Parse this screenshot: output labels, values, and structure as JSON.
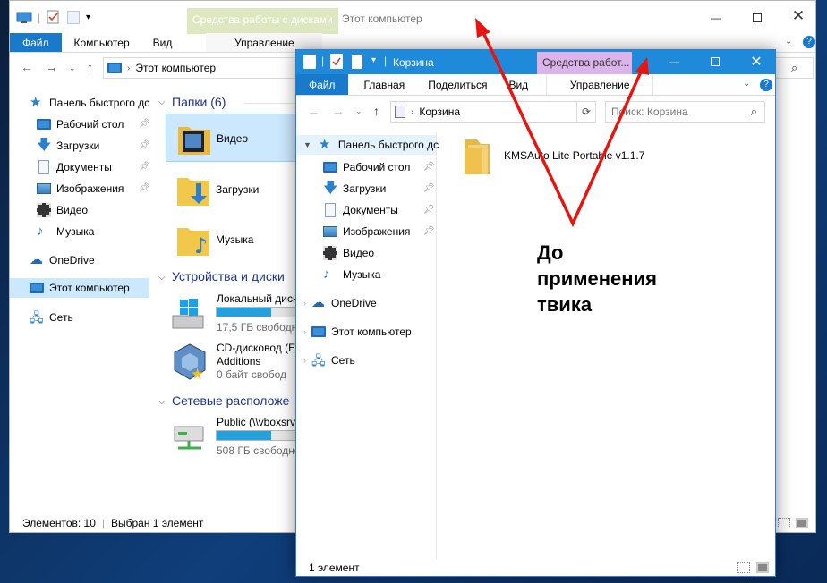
{
  "back": {
    "ribbon_context_label": "Средства работы с дисками",
    "title": "Этот компьютер",
    "tabs": [
      "Файл",
      "Компьютер",
      "Вид",
      "Управление"
    ],
    "address_root": "Этот компьютер",
    "nav": [
      "Панель быстрого дс",
      "Рабочий стол",
      "Загрузки",
      "Документы",
      "Изображения",
      "Видео",
      "Музыка",
      "OneDrive",
      "Этот компьютер",
      "Сеть"
    ],
    "groups": [
      "Папки (6)",
      "Устройства и диски",
      "Сетевые расположе"
    ],
    "folders": [
      "Видео",
      "Загрузки",
      "Музыка"
    ],
    "drives": [
      {
        "name": "Локальный диск",
        "free": "17,5 ГБ свободно",
        "fill": 0.62
      },
      {
        "name": "CD-дисковод (E:",
        "name2": "Additions",
        "free": "0 байт свобод",
        "fill": 1.0
      }
    ],
    "network": [
      {
        "name": "Public (\\\\vboxsrv",
        "free": "508 ГБ свободно",
        "fill": 0.62
      }
    ],
    "status_items": "Элементов: 10",
    "status_selected": "Выбран 1 элемент"
  },
  "front": {
    "title": "Корзина",
    "ribbon_context_label": "Средства работ...",
    "tabs": [
      "Файл",
      "Главная",
      "Поделиться",
      "Вид",
      "Управление"
    ],
    "address": "Корзина",
    "search_placeholder": "Поиск: Корзина",
    "nav": [
      "Панель быстрого дс",
      "Рабочий стол",
      "Загрузки",
      "Документы",
      "Изображения",
      "Видео",
      "Музыка",
      "OneDrive",
      "Этот компьютер",
      "Сеть"
    ],
    "item": "KMSAuto Lite Portable v1.1.7",
    "status": "1 элемент"
  },
  "annotation": {
    "lines": [
      "До",
      "применения",
      "твика"
    ],
    "color": "#e8140f"
  },
  "colors": {
    "accent": "#1979ca",
    "context_tab": "#dde8c0",
    "context_tab_front": "#dcb4ec"
  }
}
